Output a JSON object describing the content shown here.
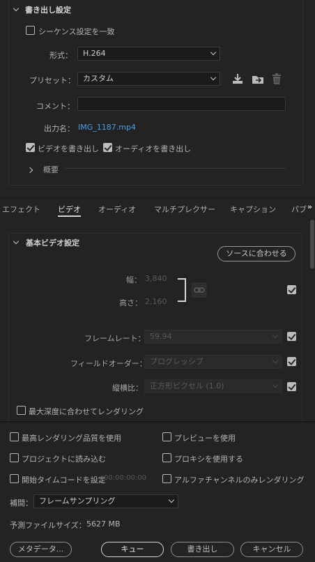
{
  "export_settings": {
    "section_title": "書き出し設定",
    "match_sequence_label": "シーケンス設定を一致",
    "format_label": "形式：",
    "format_value": "H.264",
    "preset_label": "プリセット：",
    "preset_value": "カスタム",
    "comment_label": "コメント：",
    "comment_value": "",
    "output_name_label": "出力名：",
    "output_name_value": "IMG_1187.mp4",
    "export_video_label": "ビデオを書き出し",
    "export_audio_label": "オーディオを書き出し",
    "summary_label": "概要",
    "export_video_checked": true,
    "export_audio_checked": true,
    "match_sequence_checked": false
  },
  "tabs": [
    {
      "label": "エフェクト",
      "active": false
    },
    {
      "label": "ビデオ",
      "active": true
    },
    {
      "label": "オーディオ",
      "active": false
    },
    {
      "label": "マルチプレクサー",
      "active": false
    },
    {
      "label": "キャプション",
      "active": false
    },
    {
      "label": "パブ",
      "active": false
    }
  ],
  "tabs_overflow_icon": "»",
  "video": {
    "section_title": "基本ビデオ設定",
    "match_source_button": "ソースに合わせる",
    "width_label": "幅：",
    "width_value": "3,840",
    "height_label": "高さ：",
    "height_value": "2,160",
    "frame_rate_label": "フレームレート：",
    "frame_rate_value": "59.94",
    "field_order_label": "フィールドオーダー：",
    "field_order_value": "プログレッシブ",
    "aspect_label": "縦横比：",
    "aspect_value": "正方形ピクセル (1.0)",
    "max_depth_label": "最大深度に合わせてレンダリング"
  },
  "bottom": {
    "max_quality_label": "最高レンダリング品質を使用",
    "use_preview_label": "プレビューを使用",
    "import_project_label": "プロジェクトに読み込む",
    "use_proxy_label": "プロキシを使用する",
    "set_start_timecode_label": "開始タイムコードを設定",
    "timecode_value": "00:00:00:00",
    "render_alpha_label": "アルファチャンネルのみレンダリング",
    "interpolation_label": "補間：",
    "interpolation_value": "フレームサンプリング",
    "estimated_size_label": "予測ファイルサイズ：",
    "estimated_size_value": "5627 MB",
    "metadata_button": "メタデータ...",
    "queue_button": "キュー",
    "export_button": "書き出し",
    "cancel_button": "キャンセル"
  }
}
